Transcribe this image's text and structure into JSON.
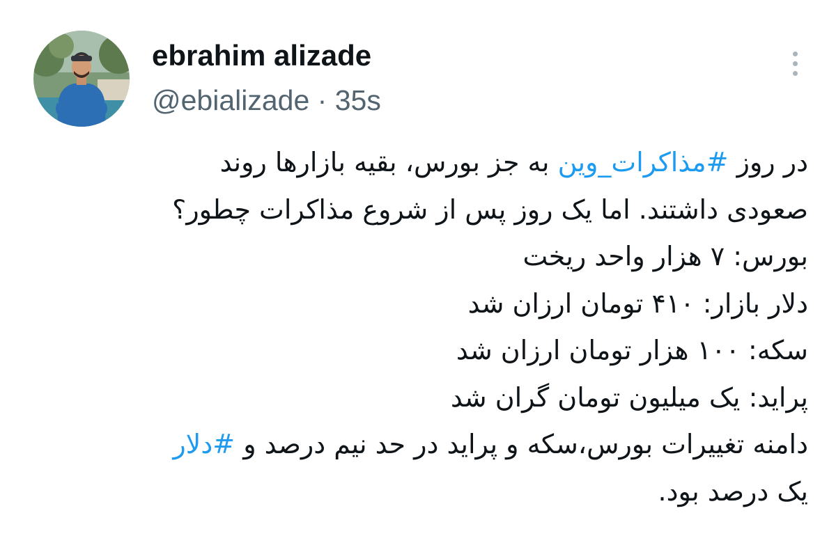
{
  "author": {
    "display_name": "ebrahim alizade",
    "handle": "@ebializade",
    "separator": "·",
    "timestamp": "35s",
    "avatar_icon": "user-avatar-photo"
  },
  "more_icon": "more-vertical-icon",
  "colors": {
    "text": "#0f1419",
    "secondary": "#536471",
    "hashtag": "#1d9bf0",
    "background": "#ffffff"
  },
  "body": {
    "line1": {
      "before": "در روز ",
      "hashtag": "#مذاکرات_وین",
      "after": " به جز بورس، بقیه بازارها روند"
    },
    "line2": "صعودی داشتند. اما یک روز پس از شروع مذاکرات چطور؟",
    "line3": "بورس: ۷ هزار واحد ریخت",
    "line4": "دلار بازار: ۴۱۰ تومان ارزان شد",
    "line5": "سکه: ۱۰۰ هزار تومان ارزان شد",
    "line6": "پراید: یک میلیون تومان گران شد",
    "line7": {
      "before": "دامنه تغییرات بورس،سکه و پراید در حد نیم درصد و ",
      "hashtag": "#دلار"
    },
    "line8": "یک درصد بود."
  }
}
